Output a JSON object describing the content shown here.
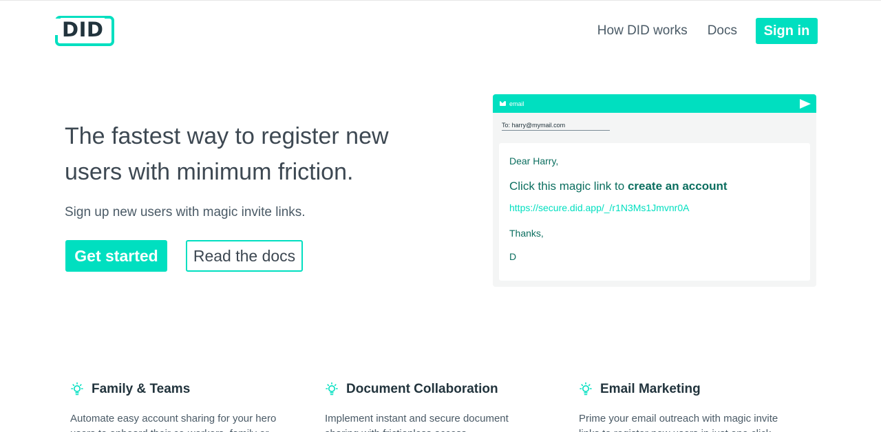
{
  "header": {
    "logo_text": "DID",
    "nav": [
      "How DID works",
      "Docs"
    ],
    "signin_label": "Sign in"
  },
  "hero": {
    "title": "The fastest way to register new users with minimum friction.",
    "subtitle": "Sign up new users with magic invite links.",
    "primary_cta": "Get started",
    "secondary_cta": "Read the docs"
  },
  "email_mock": {
    "bar_label": "email",
    "to": "To: harry@mymail.com",
    "greeting": "Dear Harry,",
    "click_text": "Click this magic link to",
    "click_bold": "create an account",
    "link": "https://secure.did.app/_/r1N3Ms1Jmvnr0A",
    "thanks": "Thanks,",
    "signature": "D"
  },
  "features": [
    {
      "icon": "lightbulb-icon",
      "title": "Family & Teams",
      "desc": "Automate easy account sharing for your hero users to onboard their co-workers, family or"
    },
    {
      "icon": "lightbulb-icon",
      "title": "Document Collaboration",
      "desc": "Implement instant and secure document sharing with frictionless access"
    },
    {
      "icon": "lightbulb-icon",
      "title": "Email Marketing",
      "desc": "Prime your email outreach with magic invite links to register new users in just one click"
    }
  ],
  "colors": {
    "accent": "#00dfc0",
    "text_dark": "#22343d",
    "text": "#3d4852",
    "email_text": "#0b6e5f"
  }
}
